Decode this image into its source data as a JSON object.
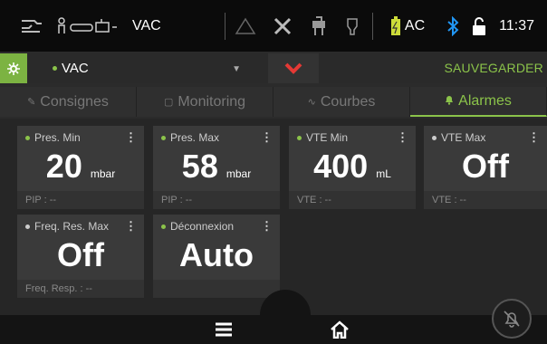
{
  "statusbar": {
    "mode": "VAC",
    "power": "AC",
    "time": "11:37"
  },
  "modebar": {
    "mode_value": "VAC",
    "save_label": "SAUVEGARDER"
  },
  "tabs": [
    {
      "label": "Consignes",
      "icon": "wrench-icon",
      "active": false
    },
    {
      "label": "Monitoring",
      "icon": "monitor-icon",
      "active": false
    },
    {
      "label": "Courbes",
      "icon": "wave-icon",
      "active": false
    },
    {
      "label": "Alarmes",
      "icon": "bell-icon",
      "active": true
    }
  ],
  "cards": [
    {
      "title": "Pres. Min",
      "value": "20",
      "unit": "mbar",
      "footer": "PIP : --"
    },
    {
      "title": "Pres. Max",
      "value": "58",
      "unit": "mbar",
      "footer": "PIP : --"
    },
    {
      "title": "VTE Min",
      "value": "400",
      "unit": "mL",
      "footer": "VTE : --"
    },
    {
      "title": "VTE Max",
      "value": "Off",
      "unit": "",
      "footer": "VTE : --"
    },
    {
      "title": "Freq. Res. Max",
      "value": "Off",
      "unit": "",
      "footer": "Freq. Resp. : --"
    },
    {
      "title": "Déconnexion",
      "value": "Auto",
      "unit": "",
      "footer": ""
    }
  ],
  "colors": {
    "accent": "#8bc34a",
    "chevron": "#e53935",
    "battery": "#cddc39",
    "bluetooth": "#2196f3"
  }
}
